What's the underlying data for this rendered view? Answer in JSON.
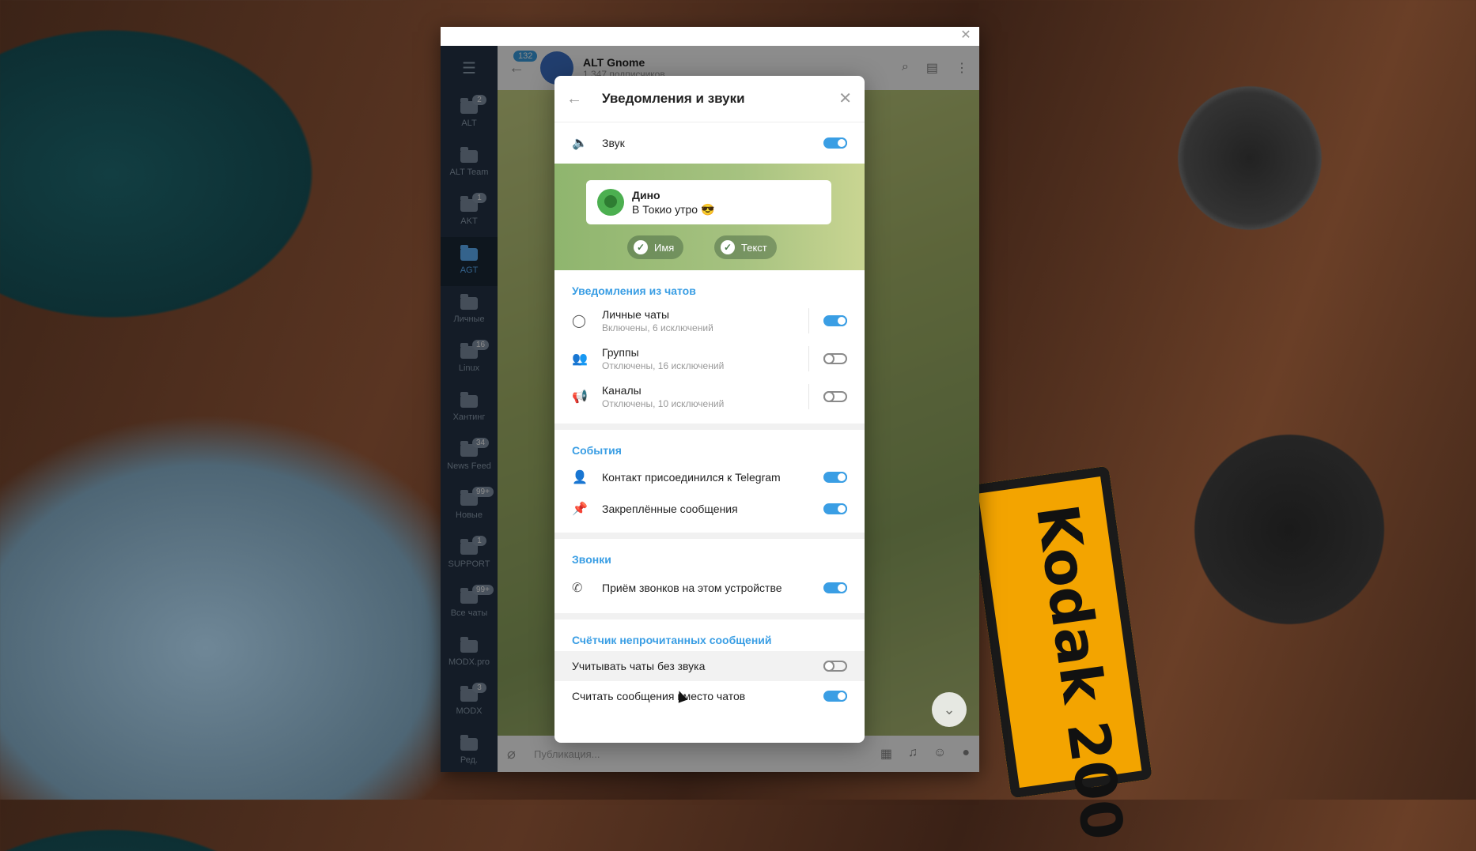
{
  "folders": {
    "items": [
      {
        "label": "ALT",
        "badge": "2",
        "active": false
      },
      {
        "label": "ALT Team",
        "badge": "",
        "active": false
      },
      {
        "label": "AKT",
        "badge": "1",
        "active": false
      },
      {
        "label": "AGT",
        "badge": "",
        "active": true
      },
      {
        "label": "Личные",
        "badge": "",
        "active": false
      },
      {
        "label": "Linux",
        "badge": "16",
        "active": false
      },
      {
        "label": "Хантинг",
        "badge": "",
        "active": false
      },
      {
        "label": "News Feed",
        "badge": "34",
        "active": false
      },
      {
        "label": "Новые",
        "badge": "99+",
        "active": false
      },
      {
        "label": "SUPPORT",
        "badge": "1",
        "active": false
      },
      {
        "label": "Все чаты",
        "badge": "99+",
        "active": false
      },
      {
        "label": "MODX.pro",
        "badge": "",
        "active": false
      },
      {
        "label": "MODX",
        "badge": "3",
        "active": false
      },
      {
        "label": "Ред.",
        "badge": "",
        "active": false
      }
    ]
  },
  "chat": {
    "unread_badge": "132",
    "name": "ALT Gnome",
    "subscribers": "1 347 подписчиков",
    "input_placeholder": "Публикация..."
  },
  "dialog": {
    "title": "Уведомления и звуки",
    "sound_label": "Звук",
    "sound_on": true,
    "preview": {
      "name": "Дино",
      "message": "В Токио утро 😎",
      "chip_name": "Имя",
      "chip_text": "Текст"
    },
    "chats_section": {
      "title": "Уведомления из чатов",
      "rows": [
        {
          "label": "Личные чаты",
          "sub": "Включены, 6 исключений",
          "on": true
        },
        {
          "label": "Группы",
          "sub": "Отключены, 16 исключений",
          "on": false
        },
        {
          "label": "Каналы",
          "sub": "Отключены, 10 исключений",
          "on": false
        }
      ]
    },
    "events_section": {
      "title": "События",
      "rows": [
        {
          "label": "Контакт присоединился к Telegram",
          "on": true
        },
        {
          "label": "Закреплённые сообщения",
          "on": true
        }
      ]
    },
    "calls_section": {
      "title": "Звонки",
      "rows": [
        {
          "label": "Приём звонков на этом устройстве",
          "on": true
        }
      ]
    },
    "counter_section": {
      "title": "Счётчик непрочитанных сообщений",
      "rows": [
        {
          "label": "Учитывать чаты без звука",
          "on": false
        },
        {
          "label": "Считать сообщения вместо чатов",
          "on": true
        }
      ]
    }
  },
  "background": {
    "film_text": "Kodak 200"
  },
  "colors": {
    "accent": "#3a9ee4",
    "sidebar": "#253447"
  }
}
